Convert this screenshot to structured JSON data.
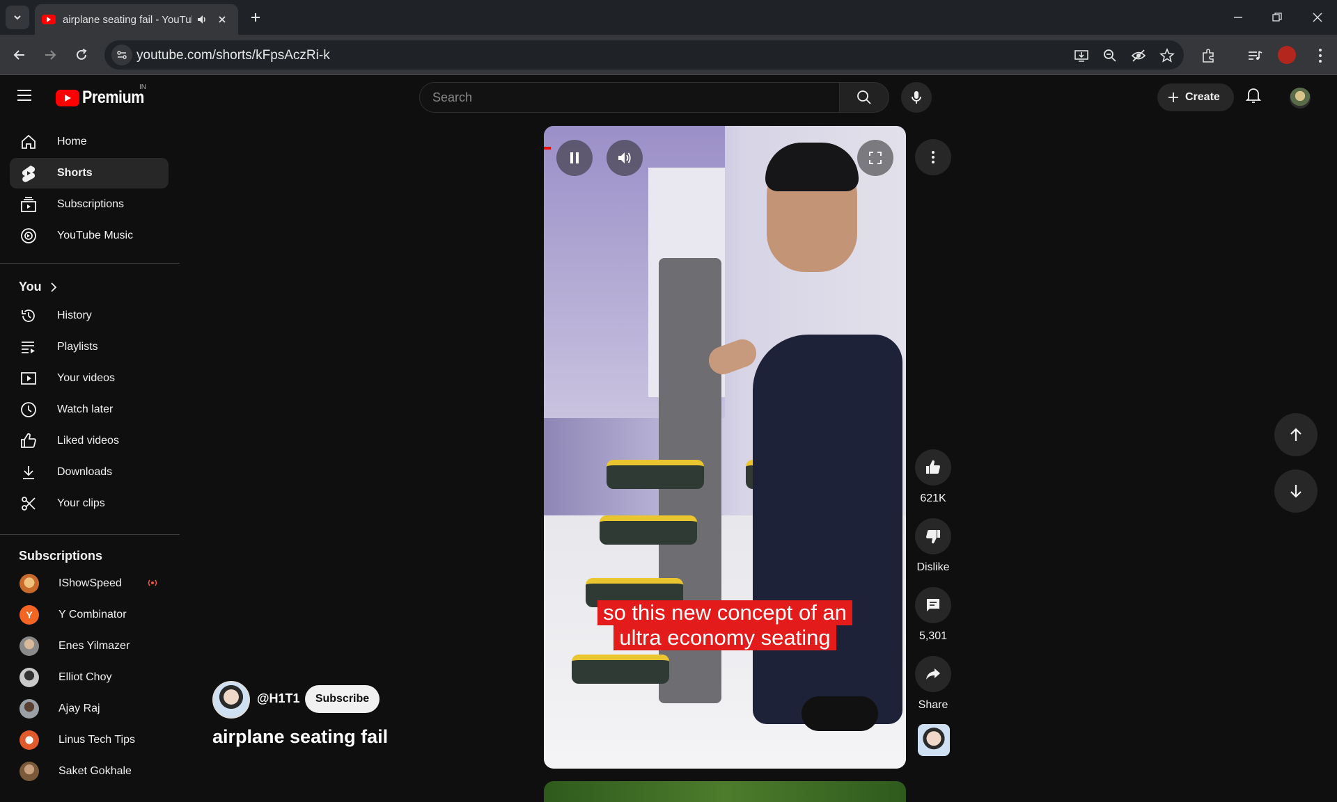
{
  "browser": {
    "tab_title": "airplane seating fail - YouTube",
    "url": "youtube.com/shorts/kFpsAczRi-k"
  },
  "masthead": {
    "logo_text": "Premium",
    "country_code": "IN",
    "search_placeholder": "Search",
    "create_label": "Create"
  },
  "sidebar": {
    "main": [
      {
        "label": "Home",
        "icon": "home-icon"
      },
      {
        "label": "Shorts",
        "icon": "shorts-icon",
        "active": true
      },
      {
        "label": "Subscriptions",
        "icon": "subscriptions-icon"
      },
      {
        "label": "YouTube Music",
        "icon": "youtube-music-icon"
      }
    ],
    "you_heading": "You",
    "you": [
      {
        "label": "History",
        "icon": "history-icon"
      },
      {
        "label": "Playlists",
        "icon": "playlists-icon"
      },
      {
        "label": "Your videos",
        "icon": "your-videos-icon"
      },
      {
        "label": "Watch later",
        "icon": "watch-later-icon"
      },
      {
        "label": "Liked videos",
        "icon": "like-icon"
      },
      {
        "label": "Downloads",
        "icon": "download-icon"
      },
      {
        "label": "Your clips",
        "icon": "scissors-icon"
      }
    ],
    "subscriptions_heading": "Subscriptions",
    "subscriptions": [
      {
        "label": "IShowSpeed",
        "live": true,
        "color": "#c86a2c"
      },
      {
        "label": "Y Combinator",
        "live": false,
        "color": "#f26522"
      },
      {
        "label": "Enes Yilmazer",
        "live": false,
        "color": "#8a8a8a"
      },
      {
        "label": "Elliot Choy",
        "live": false,
        "color": "#6c6c6c"
      },
      {
        "label": "Ajay Raj",
        "live": false,
        "color": "#9aa0a6"
      },
      {
        "label": "Linus Tech Tips",
        "live": false,
        "color": "#e05a2b"
      },
      {
        "label": "Saket Gokhale",
        "live": false,
        "color": "#7a5a3a"
      }
    ]
  },
  "short": {
    "caption_line1": "so this new concept of an",
    "caption_line2": "ultra economy seating",
    "likes": "621K",
    "dislike_label": "Dislike",
    "comments": "5,301",
    "share_label": "Share",
    "channel_handle": "@H1T1",
    "subscribe_label": "Subscribe",
    "title": "airplane seating fail"
  },
  "colors": {
    "accent": "#ff0000",
    "background": "#0f0f0f",
    "caption_bg": "#e31b1b"
  }
}
